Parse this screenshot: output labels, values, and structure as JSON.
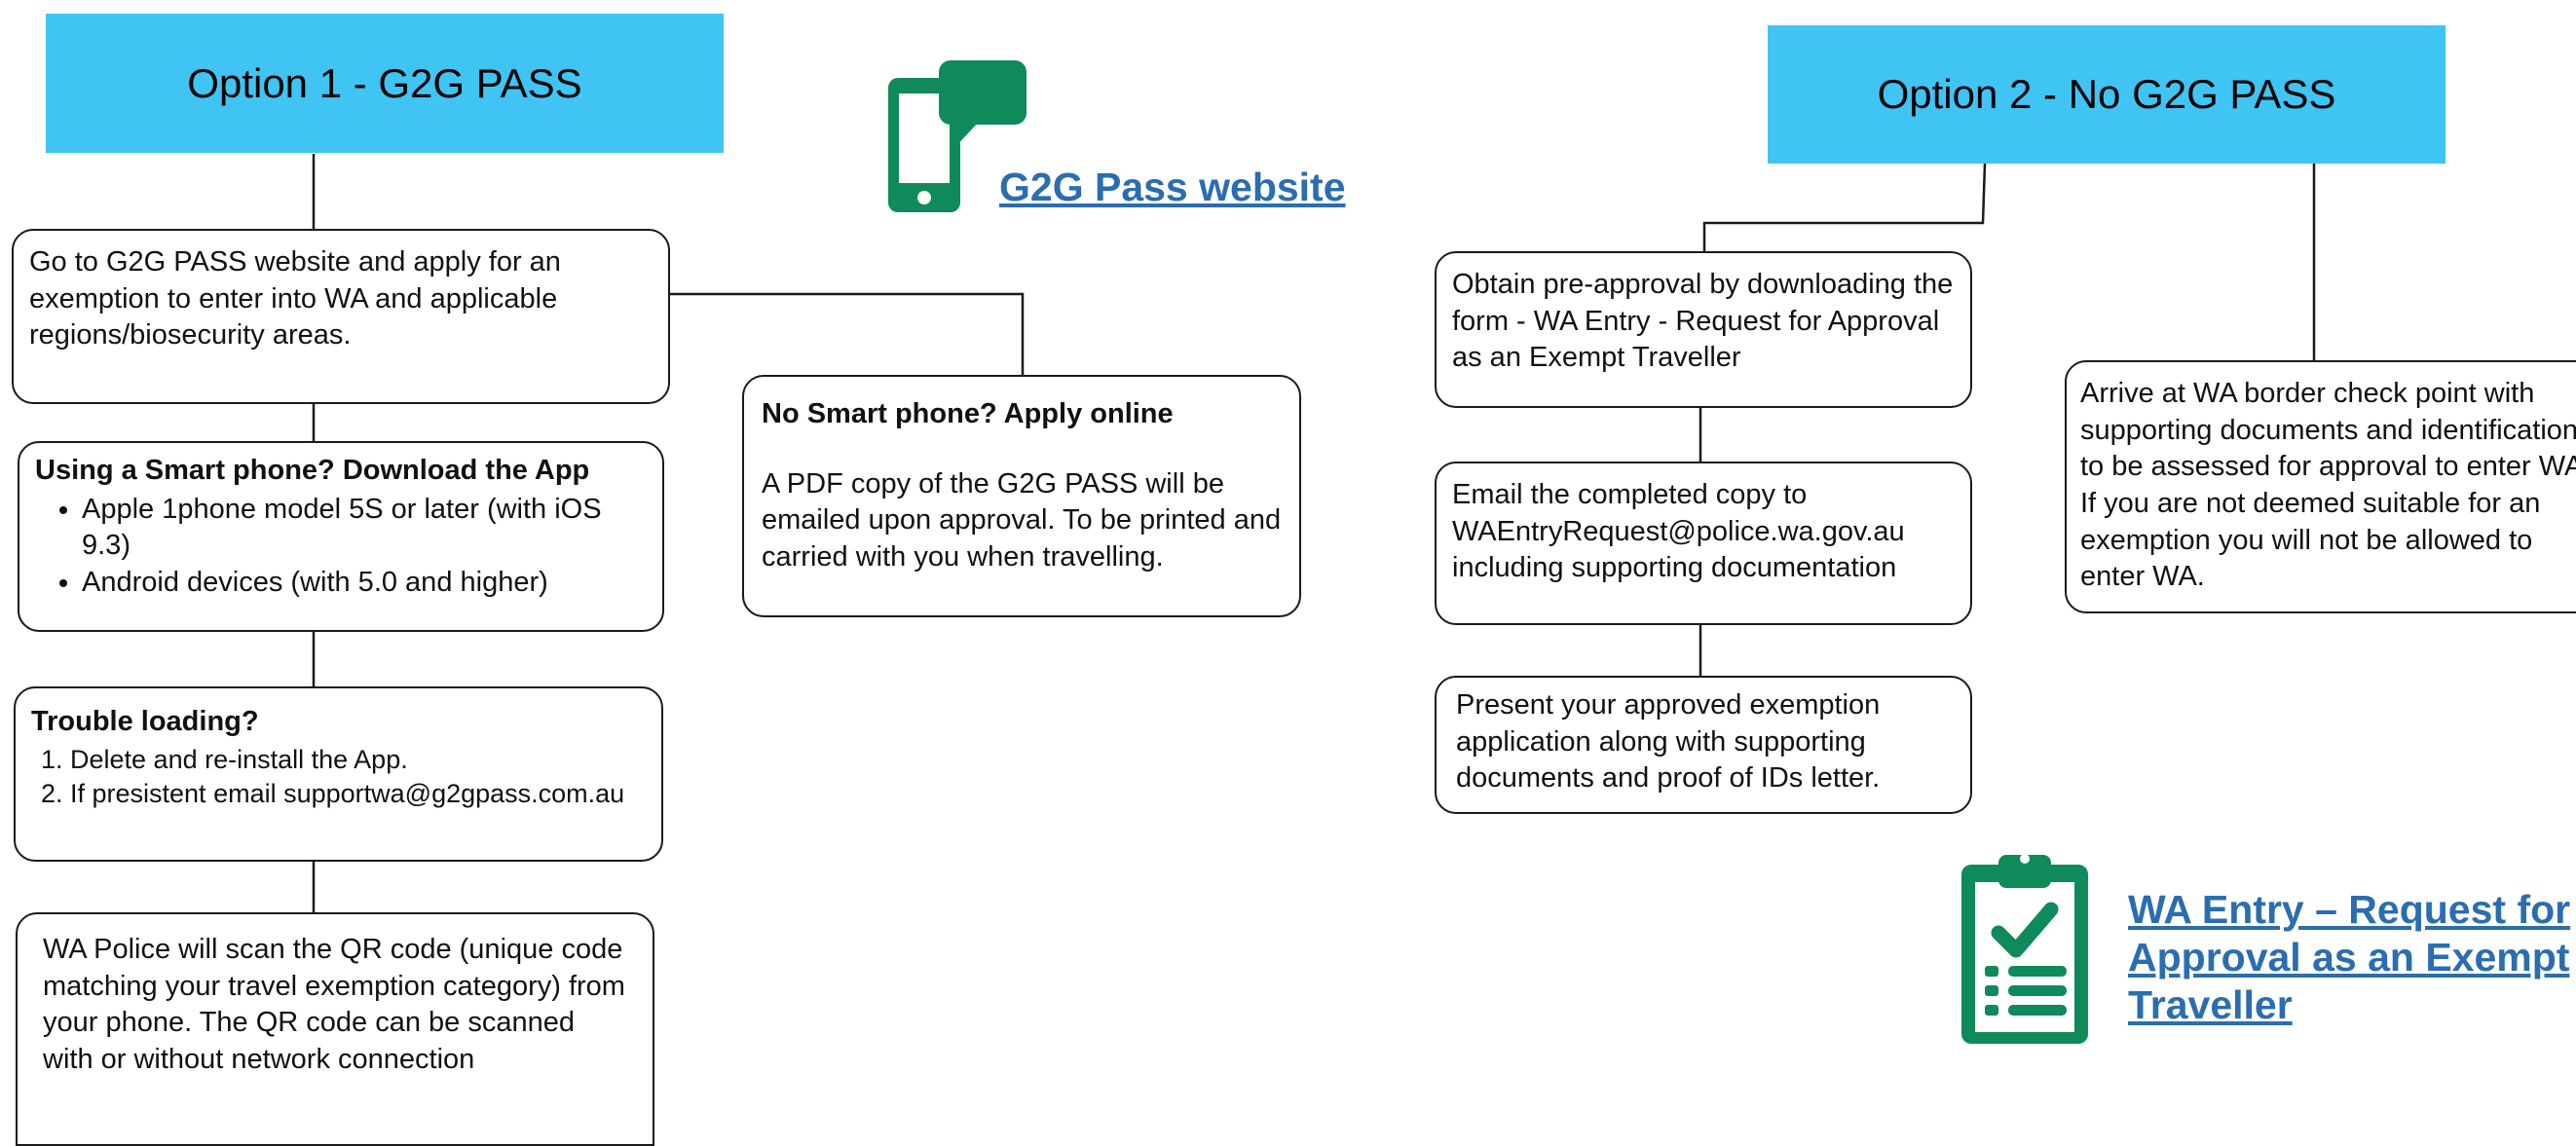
{
  "option1": {
    "title": "Option 1 - G2G PASS",
    "step1": "Go to G2G PASS website and apply for an exemption to enter into WA and applicable regions/biosecurity areas.",
    "step2": {
      "heading": "Using a Smart phone? Download the App",
      "bullets": [
        "Apple 1phone model 5S or later (with iOS 9.3)",
        "Android devices (with 5.0 and higher)"
      ]
    },
    "step3": {
      "heading": "Trouble loading?",
      "items": [
        "Delete and re-install the App.",
        "If presistent email supportwa@g2gpass.com.au"
      ]
    },
    "step4": "WA Police will scan the QR code (unique code matching your travel exemption category) from your phone. The QR code can be scanned  with or without network connection",
    "no_smartphone": {
      "heading": "No Smart phone? Apply online",
      "body": "A PDF copy of the G2G PASS will be emailed upon approval. To be printed and carried with you when travelling."
    },
    "website_link": "G2G Pass website",
    "website_icon": "smartphone-chat-icon"
  },
  "option2": {
    "title": "Option 2 - No G2G PASS",
    "step1": "Obtain pre-approval by downloading the form - WA Entry - Request for Approval as an Exempt Traveller",
    "step2": "Email the completed copy to WAEntryRequest@police.wa.gov.au including supporting documentation",
    "step3": "Present your approved exemption application along with supporting documents and proof of IDs letter.",
    "border": "Arrive at WA border check point with supporting documents and identification to be assessed for approval to enter WA.  If you are not deemed suitable for an exemption you will not be allowed to enter WA.",
    "form_link": "WA Entry – Request for Approval as an Exempt Traveller",
    "form_icon": "clipboard-checklist-icon"
  },
  "colors": {
    "header_bg": "#40c4f4",
    "link": "#2a6db0",
    "icon_green": "#0f8a5a",
    "border": "#1a1a1a"
  }
}
